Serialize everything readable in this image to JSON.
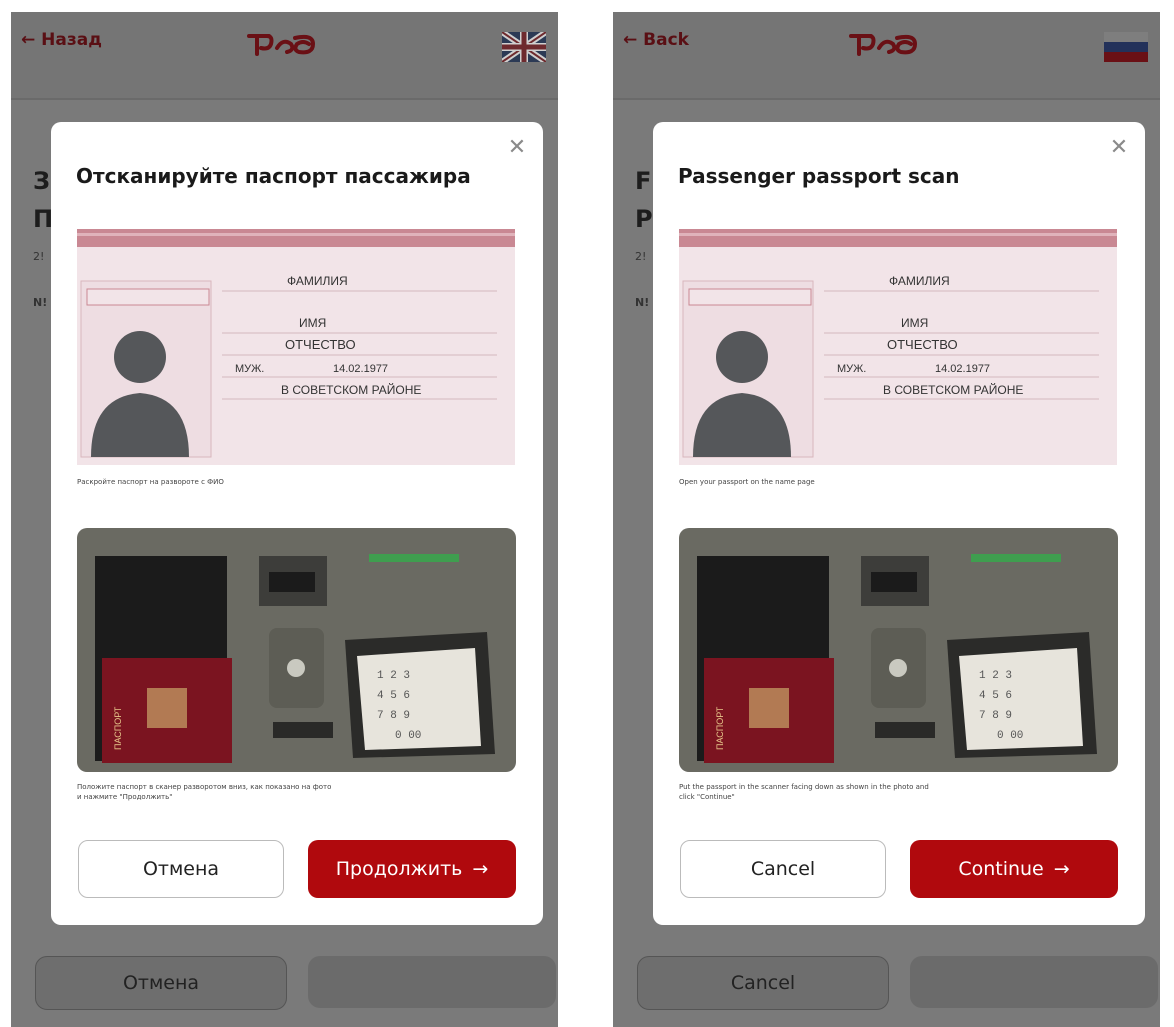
{
  "screens": [
    {
      "topbar": {
        "back_label": "← Назад",
        "logo_text": "РЖД",
        "flag_icon": "uk-flag-icon"
      },
      "background": {
        "letters": [
          "З",
          "П"
        ],
        "line1": "2!",
        "line2": "N!",
        "cancel_label": "Отмена"
      },
      "modal": {
        "title": "Отсканируйте паспорт пассажира",
        "caption1": "Раскройте паспорт на развороте с ФИО",
        "caption2": "Положите паспорт в сканер разворотом вниз, как показано на фото и нажмите \"Продолжить\"",
        "cancel_label": "Отмена",
        "continue_label": "Продолжить",
        "continue_icon": "arrow-right-icon",
        "passport": {
          "surname": "ФАМИЛИЯ",
          "name": "ИМЯ",
          "patronymic": "ОТЧЕСТВО",
          "sex": "МУЖ.",
          "birthdate": "14.02.1977",
          "birthplace": "В СОВЕТСКОМ РАЙОНЕ"
        },
        "kiosk": {
          "passport_text": "ПАСПОРТ",
          "keys": [
            "1",
            "2",
            "3",
            "4",
            "5",
            "6",
            "7",
            "8",
            "9",
            "0",
            "00"
          ]
        }
      }
    },
    {
      "topbar": {
        "back_label": "← Back",
        "logo_text": "РЖД",
        "flag_icon": "russia-flag-icon"
      },
      "background": {
        "letters": [
          "F",
          "P"
        ],
        "line1": "2!",
        "line2": "N!",
        "cancel_label": "Cancel"
      },
      "modal": {
        "title": "Passenger passport scan",
        "caption1": "Open your passport on the name page",
        "caption2": "Put the passport in the scanner facing down as shown in the photo and click \"Continue\"",
        "cancel_label": "Cancel",
        "continue_label": "Continue",
        "continue_icon": "arrow-right-icon",
        "passport": {
          "surname": "ФАМИЛИЯ",
          "name": "ИМЯ",
          "patronymic": "ОТЧЕСТВО",
          "sex": "МУЖ.",
          "birthdate": "14.02.1977",
          "birthplace": "В СОВЕТСКОМ РАЙОНЕ"
        },
        "kiosk": {
          "passport_text": "ПАСПОРТ",
          "keys": [
            "1",
            "2",
            "3",
            "4",
            "5",
            "6",
            "7",
            "8",
            "9",
            "0",
            "00"
          ]
        }
      }
    }
  ],
  "colors": {
    "accent": "#b0090d",
    "overlay": "#7a7a7a",
    "back_text": "#5a0f14"
  }
}
